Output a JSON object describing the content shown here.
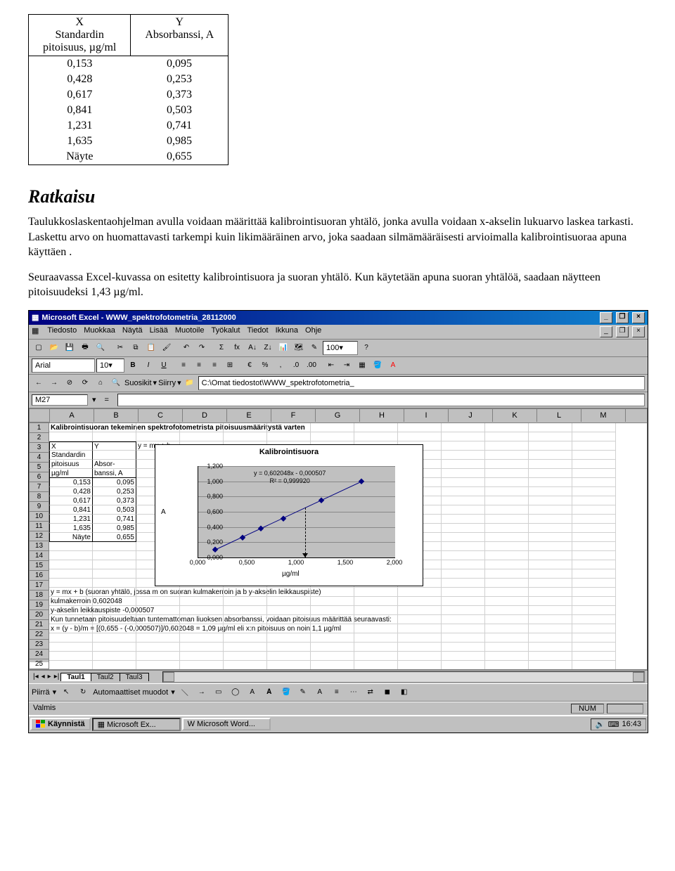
{
  "table": {
    "header_x_1": "X",
    "header_x_2": "Standardin",
    "header_x_3": "pitoisuus, µg/ml",
    "header_y_1": "Y",
    "header_y_2": "Absorbanssi, A",
    "rows": [
      {
        "x": "0,153",
        "y": "0,095"
      },
      {
        "x": "0,428",
        "y": "0,253"
      },
      {
        "x": "0,617",
        "y": "0,373"
      },
      {
        "x": "0,841",
        "y": "0,503"
      },
      {
        "x": "1,231",
        "y": "0,741"
      },
      {
        "x": "1,635",
        "y": "0,985"
      },
      {
        "x": "Näyte",
        "y": "0,655"
      }
    ]
  },
  "heading": "Ratkaisu",
  "para1": "Taulukkoslaskentaohjelman avulla voidaan määrittää kalibrointisuoran yhtä­lö, jonka avulla voidaan x-akselin lukuarvo laskea tarkasti. Laskettu arvo on huomattavasti tarkempi kuin likimääräinen arvo, joka saadaan silmä­määräisesti arvioimalla kalibrointisuoraa apuna käyttäen .",
  "para2": "Seuraavassa Excel-kuvassa on esitetty kalibrointisuora ja suoran yhtälö. Kun käytetään apuna suoran yhtälöä, saadaan näytteen pitoisuudeksi 1,43 µg/ml.",
  "excel": {
    "title": "Microsoft Excel - WWW_spektrofotometria_28112000",
    "menu": [
      "Tiedosto",
      "Muokkaa",
      "Näytä",
      "Lisää",
      "Muotoile",
      "Työkalut",
      "Tiedot",
      "Ikkuna",
      "Ohje"
    ],
    "font_name": "Arial",
    "font_size": "10",
    "zoom": "100",
    "fav_label": "Suosikit",
    "go_label": "Siirry",
    "address": "C:\\Omat tiedostot\\WWW_spektrofotometria_",
    "active_cell": "M27",
    "columns": [
      "A",
      "B",
      "C",
      "D",
      "E",
      "F",
      "G",
      "H",
      "I",
      "J",
      "K",
      "L",
      "M"
    ],
    "row_count": 27,
    "rows": {
      "1": {
        "A": "Kalibrointisuoran tekeminen spektrofotometrista pitoisuusmääritystä varten",
        "bold": true
      },
      "3": {
        "A": "X",
        "B": "Y",
        "C": "y = mx + b"
      },
      "4": {
        "A": "Standardin"
      },
      "5": {
        "A": "pitoisuus",
        "B": "Absor-"
      },
      "6": {
        "A": "µg/ml",
        "B": "banssi, A"
      },
      "7": {
        "A": "0,153",
        "B": "0,095"
      },
      "8": {
        "A": "0,428",
        "B": "0,253"
      },
      "9": {
        "A": "0,617",
        "B": "0,373"
      },
      "10": {
        "A": "0,841",
        "B": "0,503"
      },
      "11": {
        "A": "1,231",
        "B": "0,741"
      },
      "12": {
        "A": "1,635",
        "B": "0,985"
      },
      "13": {
        "A": "Näyte",
        "B": "0,655"
      },
      "19": {
        "A": "y = mx + b (suoran yhtälö, jossa m on suoran kulmakerroin ja b y-akselin leikkauspiste)"
      },
      "20": {
        "A": "kulmakerroin 0,602048"
      },
      "21": {
        "A": "y-akselin leikkauspiste -0,000507"
      },
      "22": {
        "A": "Kun tunnetaan pitoisuudeltaan tuntemattoman liuoksen absorbanssi, voidaan pitoisuus määrittää seuraavasti:"
      },
      "23": {
        "A": "x = (y - b)/m = [(0,655 - (-0,000507)]/0,602048 = 1,09 µg/ml eli x:n pitoisuus on noin 1,1 µg/ml"
      }
    },
    "chart": {
      "title": "Kalibrointisuora",
      "eq1": "y = 0,602048x - 0,000507",
      "eq2": "R² = 0,999920",
      "ylabel": "A",
      "xlabel": "µg/ml",
      "yticks": [
        "0,000",
        "0,200",
        "0,400",
        "0,600",
        "0,800",
        "1,000",
        "1,200"
      ],
      "xticks": [
        "0,000",
        "0,500",
        "1,000",
        "1,500",
        "2,000"
      ]
    },
    "tabs": {
      "active": "Taul1",
      "t2": "Taul2",
      "t3": "Taul3"
    },
    "draw": {
      "label": "Piirrä",
      "auto": "Automaattiset muodot"
    },
    "status": "Valmis",
    "num": "NUM"
  },
  "taskbar": {
    "start": "Käynnistä",
    "app1": "Microsoft Ex...",
    "app2": "Microsoft Word...",
    "clock": "16:43"
  },
  "chart_data": {
    "type": "scatter",
    "title": "Kalibrointisuora",
    "xlabel": "µg/ml",
    "ylabel": "A",
    "xlim": [
      0.0,
      2.0
    ],
    "ylim": [
      0.0,
      1.2
    ],
    "series": [
      {
        "name": "data",
        "x": [
          0.153,
          0.428,
          0.617,
          0.841,
          1.231,
          1.635
        ],
        "y": [
          0.095,
          0.253,
          0.373,
          0.503,
          0.741,
          0.985
        ]
      }
    ],
    "trendline": {
      "slope": 0.602048,
      "intercept": -0.000507,
      "r2": 0.99992
    },
    "annotations": [
      "y = 0,602048x - 0,000507",
      "R² = 0,999920"
    ]
  }
}
